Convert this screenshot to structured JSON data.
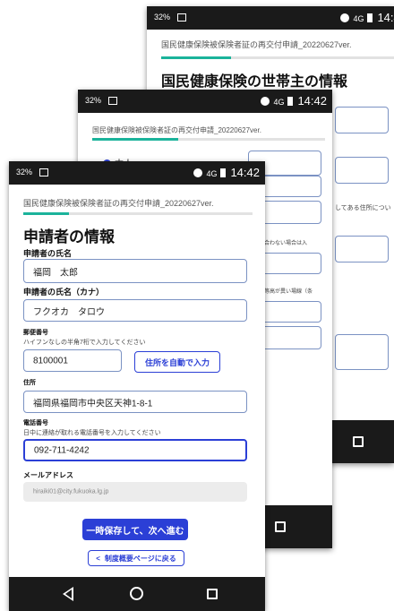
{
  "status_bar": {
    "battery": "32%",
    "time": "14:42",
    "signal": "4G"
  },
  "app_title": "国民健康保険被保険者証の再交付申請_20220627ver.",
  "back_screen": {
    "heading": "国民健康保険の世帯主の情報",
    "partial_texts": [
      "してある住所につい",
      "合わない場合は入",
      "等高が異い場線（条"
    ]
  },
  "middle_screen": {
    "radio_label": "本人"
  },
  "form": {
    "heading": "申請者の情報",
    "name_label": "申請者の氏名",
    "name_value": "福岡　太郎",
    "kana_label": "申請者の氏名（カナ）",
    "kana_value": "フクオカ　タロウ",
    "postal_label": "郵便番号",
    "postal_hint": "ハイフンなしの半角7桁で入力してください",
    "postal_value": "8100001",
    "autofill_button": "住所を自動で入力",
    "address_label": "住所",
    "address_value": "福岡県福岡市中央区天神1-8-1",
    "phone_label": "電話番号",
    "phone_hint": "日中に連絡が取れる電話番号を入力してください",
    "phone_value": "092-711-4242",
    "email_label": "メールアドレス",
    "email_value": "hiraiki01@city.fukuoka.lg.jp",
    "save_next_button": "一時保存して、次へ進む",
    "back_button": "制度概要ページに戻る"
  },
  "progress": {
    "front": 0.2,
    "middle": 0.37,
    "back": 0.3
  },
  "colors": {
    "primary": "#2b3fd6",
    "progress": "#1bb39b",
    "border": "#7b92c3",
    "bar": "#1a1a1a"
  },
  "icons": [
    "picture-icon",
    "sync-icon",
    "signal-icon",
    "battery-icon",
    "back-nav-icon",
    "home-nav-icon",
    "recents-nav-icon",
    "chevron-left-icon"
  ]
}
